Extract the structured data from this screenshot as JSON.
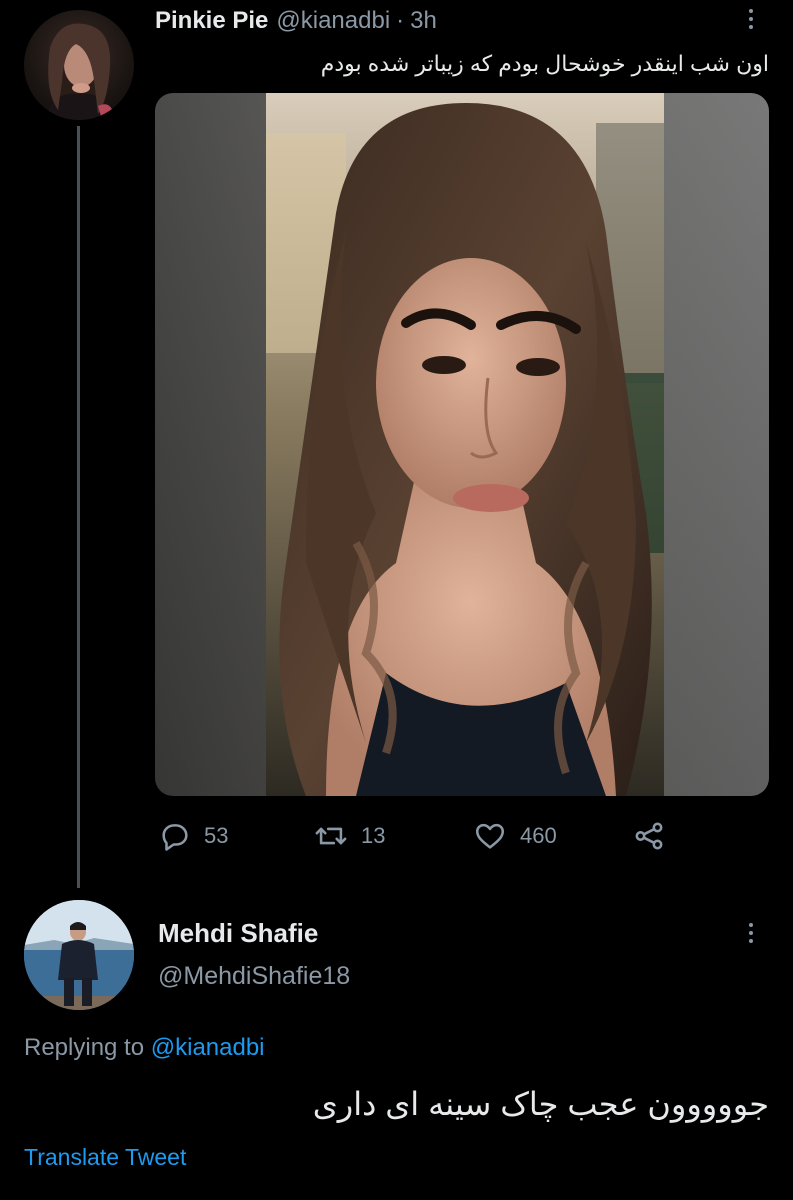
{
  "colors": {
    "background": "#000000",
    "primary_text": "#e7e9ea",
    "secondary_text": "#8b98a5",
    "link": "#1d9bf0",
    "thread_line": "#4a5056"
  },
  "tweet": {
    "author": {
      "display_name": "Pinkie Pie",
      "handle": "@kianadbi",
      "separator": "·",
      "time": "3h",
      "avatar_icon": "profile-photo"
    },
    "text": "اون شب اینقدر خوشحال بودم که زیباتر شده بودم",
    "media_icon": "selfie-photo",
    "actions": {
      "reply": {
        "icon": "reply-bubble-icon",
        "count": "53"
      },
      "retweet": {
        "icon": "retweet-arrows-icon",
        "count": "13"
      },
      "like": {
        "icon": "heart-icon",
        "count": "460"
      },
      "share": {
        "icon": "share-nodes-icon"
      }
    },
    "more_icon": "vertical-ellipsis-icon"
  },
  "reply": {
    "author": {
      "display_name": "Mehdi Shafie",
      "handle": "@MehdiShafie18",
      "avatar_icon": "profile-photo"
    },
    "replying_prefix": "Replying to",
    "replying_mention": "@kianadbi",
    "text": "جووووون عجب چاک سینه ای داری",
    "translate_label": "Translate Tweet",
    "more_icon": "vertical-ellipsis-icon"
  }
}
